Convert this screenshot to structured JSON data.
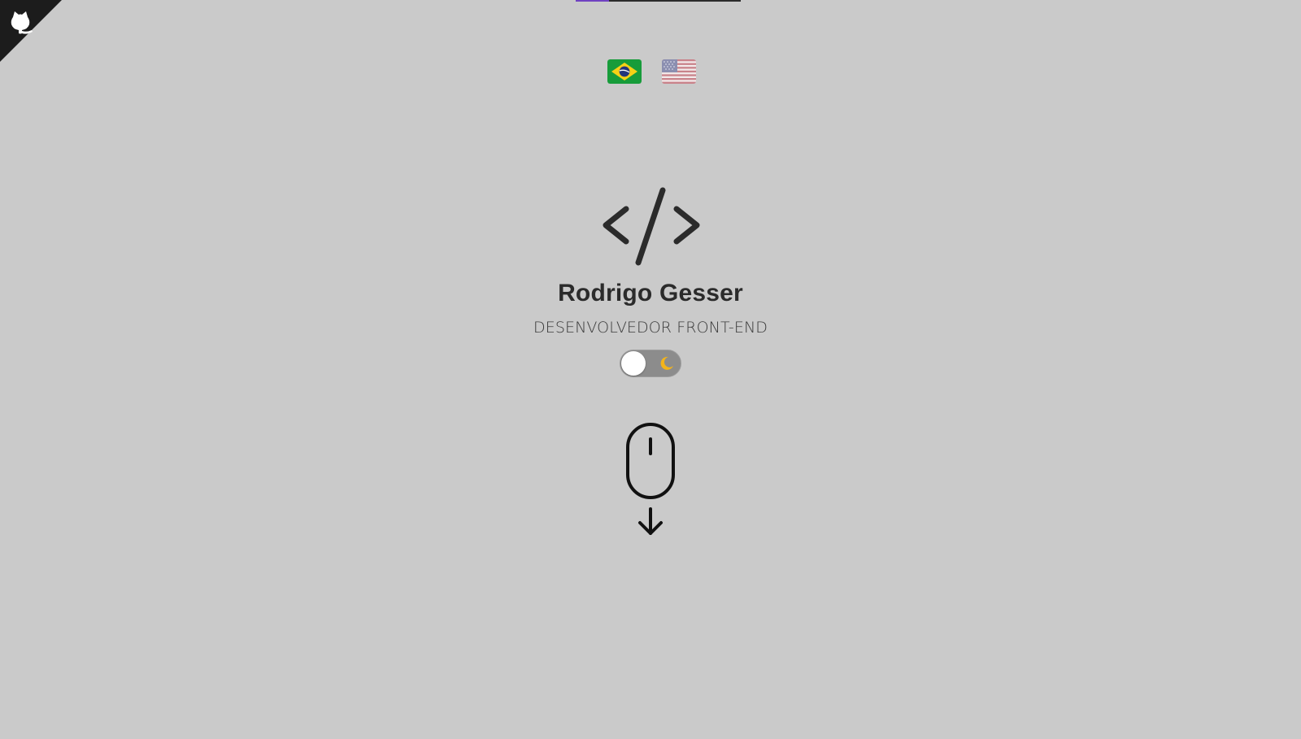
{
  "header": {
    "scroll_progress_pct": 20,
    "github_link_icon": "github-octocat-icon"
  },
  "languages": [
    {
      "code": "pt-BR",
      "icon": "brazil-flag-icon"
    },
    {
      "code": "en-US",
      "icon": "usa-flag-icon"
    }
  ],
  "hero": {
    "logo_icon": "code-brackets-icon",
    "name": "Rodrigo Gesser",
    "role": "DESENVOLVEDOR FRONT-END",
    "theme_toggle": {
      "state": "light",
      "icon": "moon-icon"
    },
    "scroll_icon": "mouse-scroll-down-icon"
  },
  "colors": {
    "background": "#cacaca",
    "text": "#2b2b2b",
    "progress_accent": "#6f42c1",
    "corner": "#1c1c1c"
  }
}
